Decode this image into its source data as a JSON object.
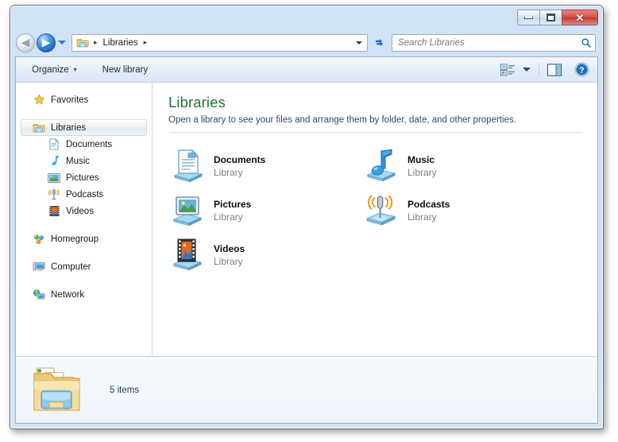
{
  "window": {
    "controls": {
      "minimize_label": "Minimize",
      "maximize_label": "Maximize",
      "close_label": "Close",
      "close_glyph": "✕"
    }
  },
  "address_bar": {
    "back_label": "Back",
    "back_glyph": "◀",
    "forward_label": "Forward",
    "forward_glyph": "▶",
    "history_label": "Recent pages",
    "breadcrumb": [
      "Libraries"
    ],
    "breadcrumb_separator": "▸",
    "refresh_label": "Refresh",
    "search": {
      "placeholder": "Search Libraries",
      "value": "",
      "icon": "search-icon"
    }
  },
  "command_bar": {
    "organize_label": "Organize",
    "organize_caret": "▾",
    "new_library_label": "New library",
    "view_label": "Change your view",
    "view_caret": "▾",
    "preview_pane_label": "Show the preview pane",
    "help_label": "Get help",
    "help_glyph": "?"
  },
  "navigation_pane": {
    "groups": [
      {
        "label": "Favorites",
        "icon": "star-icon",
        "selected": false,
        "children": []
      },
      {
        "label": "Libraries",
        "icon": "library-folder-icon",
        "selected": true,
        "children": [
          {
            "label": "Documents",
            "icon": "documents-icon"
          },
          {
            "label": "Music",
            "icon": "music-note-icon"
          },
          {
            "label": "Pictures",
            "icon": "pictures-icon"
          },
          {
            "label": "Podcasts",
            "icon": "podcast-microphone-icon"
          },
          {
            "label": "Videos",
            "icon": "videos-filmstrip-icon"
          }
        ]
      },
      {
        "label": "Homegroup",
        "icon": "homegroup-icon",
        "selected": false,
        "children": []
      },
      {
        "label": "Computer",
        "icon": "computer-icon",
        "selected": false,
        "children": []
      },
      {
        "label": "Network",
        "icon": "network-icon",
        "selected": false,
        "children": []
      }
    ]
  },
  "content": {
    "title": "Libraries",
    "subtitle": "Open a library to see your files and arrange them by folder, date, and other properties.",
    "tiles": [
      {
        "name": "Documents",
        "subtitle": "Library",
        "icon": "documents-library-icon"
      },
      {
        "name": "Music",
        "subtitle": "Library",
        "icon": "music-library-icon"
      },
      {
        "name": "Pictures",
        "subtitle": "Library",
        "icon": "pictures-library-icon"
      },
      {
        "name": "Podcasts",
        "subtitle": "Library",
        "icon": "podcasts-library-icon"
      },
      {
        "name": "Videos",
        "subtitle": "Library",
        "icon": "videos-library-icon"
      }
    ]
  },
  "status_bar": {
    "icon": "libraries-folder-icon",
    "item_count_text": "5 items"
  },
  "colors": {
    "title_accent": "#1f6f41",
    "glass": "#cfe2f6",
    "close_button": "#d5544a",
    "link_text": "#2f4a63"
  }
}
